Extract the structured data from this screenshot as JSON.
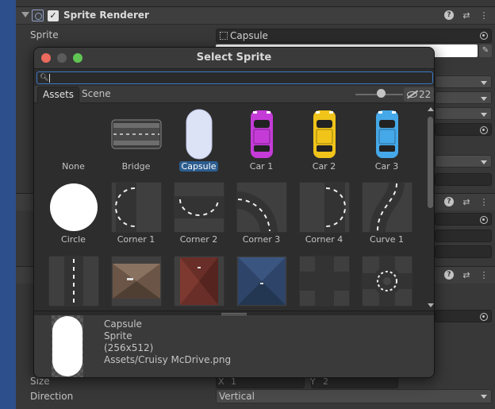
{
  "inspector": {
    "component_title": "Sprite Renderer",
    "sprite_label": "Sprite",
    "sprite_value": "Capsule",
    "size_label": "Size",
    "size_x_label": "X",
    "size_x_value": "1",
    "size_y_label": "Y",
    "size_y_value": "2",
    "direction_label": "Direction",
    "direction_value": "Vertical"
  },
  "window": {
    "title": "Select Sprite",
    "search_placeholder": "",
    "tabs": [
      {
        "label": "Assets",
        "active": true
      },
      {
        "label": "Scene",
        "active": false
      }
    ],
    "visible_count": "22",
    "selected": "Capsule"
  },
  "grid": {
    "items": [
      {
        "label": "None",
        "kind": "none"
      },
      {
        "label": "Bridge",
        "kind": "bridge"
      },
      {
        "label": "Capsule",
        "kind": "capsule"
      },
      {
        "label": "Car 1",
        "kind": "car",
        "color": "#c53bd8"
      },
      {
        "label": "Car 2",
        "kind": "car",
        "color": "#f0c419"
      },
      {
        "label": "Car 3",
        "kind": "car",
        "color": "#45a8e8"
      },
      {
        "label": "Circle",
        "kind": "circle"
      },
      {
        "label": "Corner 1",
        "kind": "corner1"
      },
      {
        "label": "Corner 2",
        "kind": "corner2"
      },
      {
        "label": "Corner 3",
        "kind": "corner3"
      },
      {
        "label": "Corner 4",
        "kind": "corner4"
      },
      {
        "label": "Curve 1",
        "kind": "curve1"
      },
      {
        "label": "",
        "kind": "road-v"
      },
      {
        "label": "",
        "kind": "roof-brown"
      },
      {
        "label": "",
        "kind": "roof-red"
      },
      {
        "label": "",
        "kind": "roof-blue"
      },
      {
        "label": "",
        "kind": "cross"
      },
      {
        "label": "",
        "kind": "roundabout"
      }
    ]
  },
  "preview": {
    "name": "Capsule",
    "type": "Sprite",
    "dimensions": "(256x512)",
    "path": "Assets/Cruisy McDrive.png"
  },
  "colors": {
    "accent": "#3a79c6",
    "selection": "#2c5d8f",
    "window_bg": "#2d2d2d",
    "inspector_bg": "#383838"
  }
}
